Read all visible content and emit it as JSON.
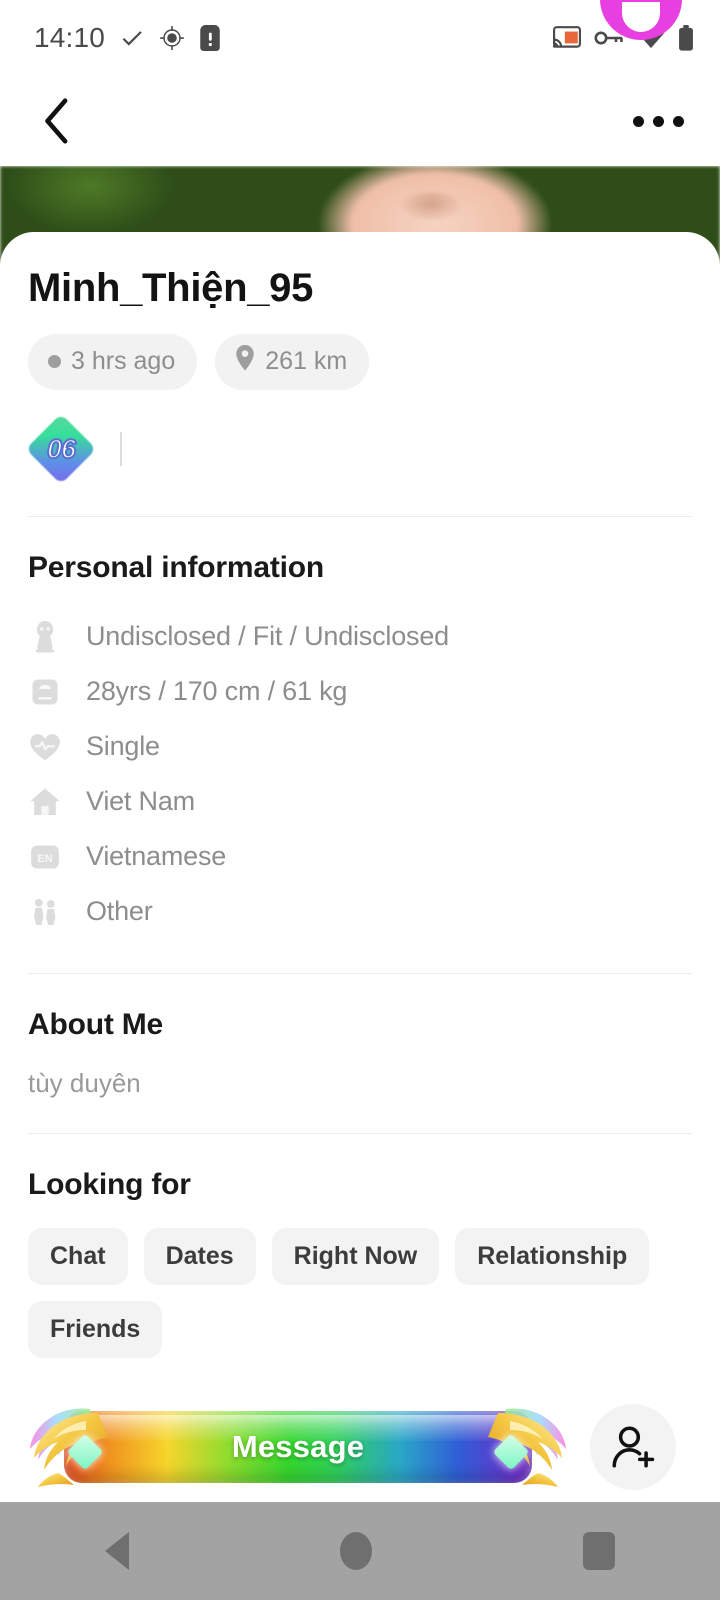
{
  "status_bar": {
    "time": "14:10",
    "left_icons": [
      "check-icon",
      "gps-location-icon",
      "sim-card-alert-icon"
    ],
    "right_icons": [
      "screen-cast-icon",
      "vpn-key-icon",
      "wifi-icon",
      "battery-icon"
    ],
    "cast_accent_color": "#e8663a"
  },
  "app_bar": {
    "back_label": "back-arrow",
    "more_label": "more-options"
  },
  "profile": {
    "username": "Minh_Thiện_95",
    "last_active": "3 hrs ago",
    "distance": "261 km",
    "level_badge": "06"
  },
  "personal_information": {
    "title": "Personal information",
    "rows": [
      {
        "icon": "body-type-icon",
        "text": "Undisclosed / Fit / Undisclosed"
      },
      {
        "icon": "weight-scale-icon",
        "text": "28yrs / 170 cm / 61 kg"
      },
      {
        "icon": "relationship-heart-icon",
        "text": "Single"
      },
      {
        "icon": "home-icon",
        "text": "Viet Nam"
      },
      {
        "icon": "language-en-icon",
        "text": "Vietnamese"
      },
      {
        "icon": "role-figures-icon",
        "text": "Other"
      }
    ]
  },
  "about_me": {
    "title": "About Me",
    "text": "tùy duyên"
  },
  "looking_for": {
    "title": "Looking for",
    "chips": [
      "Chat",
      "Dates",
      "Right Now",
      "Relationship",
      "Friends"
    ]
  },
  "actions": {
    "message_label": "Message",
    "add_friend_label": "add-friend"
  },
  "nav_bar": {
    "items": [
      "back",
      "home",
      "recents"
    ],
    "background_color": "#a3a3a3",
    "icon_color": "#6f6f6f"
  }
}
